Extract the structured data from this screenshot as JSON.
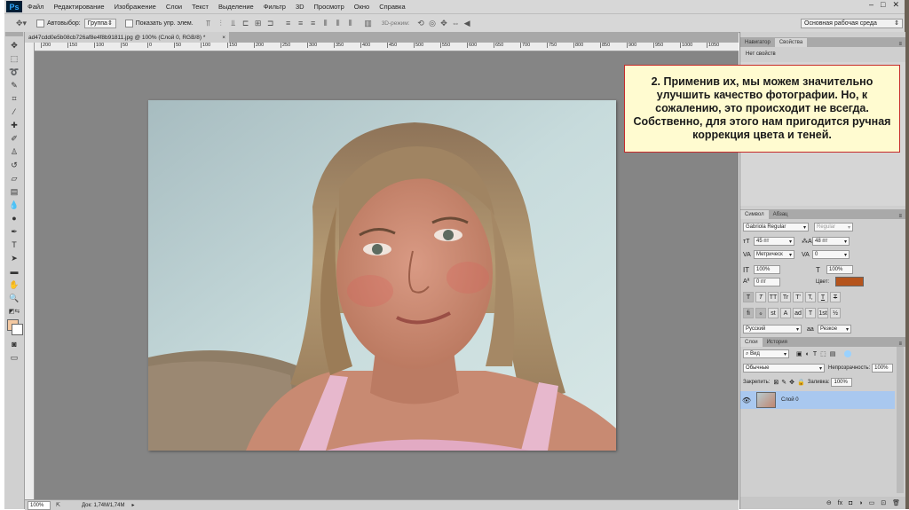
{
  "menubar": {
    "logo": "Ps",
    "items": [
      "Файл",
      "Редактирование",
      "Изображение",
      "Слои",
      "Текст",
      "Выделение",
      "Фильтр",
      "3D",
      "Просмотр",
      "Окно",
      "Справка"
    ]
  },
  "options": {
    "autoselect_label": "Автовыбор:",
    "autoselect_value": "Группа",
    "show_controls_label": "Показать упр. элем.",
    "mode_3d": "3D-режим:",
    "workspace": "Основная рабочая среда"
  },
  "document": {
    "tab_title": "ad47cdd0e5b08cb726af8e4f8b91811.jpg @ 100% (Слой 0, RGB/8) *",
    "ruler_ticks": [
      "200",
      "150",
      "100",
      "50",
      "0",
      "50",
      "100",
      "150",
      "200",
      "250",
      "300",
      "350",
      "400",
      "450",
      "500",
      "550",
      "600",
      "650",
      "700",
      "750",
      "800",
      "850",
      "900",
      "950",
      "1000",
      "1050"
    ],
    "zoom": "100%",
    "doc_size": "Док: 1,74M/1,74M"
  },
  "callout": {
    "text": "2. Применив их, мы можем значительно улучшить качество фотографии. Но, к сожалению, это происходит не всегда. Собственно, для этого нам пригодится ручная коррекция цвета и теней."
  },
  "properties_panel": {
    "tab_navigator": "Навигатор",
    "tab_properties": "Свойства",
    "empty_text": "Нет свойств"
  },
  "character_panel": {
    "tab_character": "Символ",
    "tab_paragraph": "Абзац",
    "font_family": "Gabriola Regular",
    "font_style": "Regular",
    "font_size": "45 пт",
    "leading": "48 пт",
    "kerning": "Метрическ",
    "tracking": "0",
    "vertical_scale": "100%",
    "horizontal_scale": "100%",
    "baseline": "0 пт",
    "color_label": "Цвет:",
    "text_color": "#b5541d",
    "style_buttons": [
      "T",
      "T",
      "TT",
      "Tr",
      "T'",
      "T,",
      "T",
      "T"
    ],
    "opentype_buttons": [
      "fi",
      "ℴ",
      "st",
      "A",
      "ad",
      "T",
      "1st",
      "½"
    ],
    "language": "Русский",
    "aa_label": "aa",
    "antialias": "Резкое"
  },
  "layers_panel": {
    "tab_layers": "Слои",
    "tab_history": "История",
    "filter_kind": "Вид",
    "blend_mode": "Обычные",
    "opacity_label": "Непрозрачность:",
    "opacity": "100%",
    "lock_label": "Закрепить:",
    "fill_label": "Заливка:",
    "fill": "100%",
    "layer_name": "Слой 0"
  }
}
